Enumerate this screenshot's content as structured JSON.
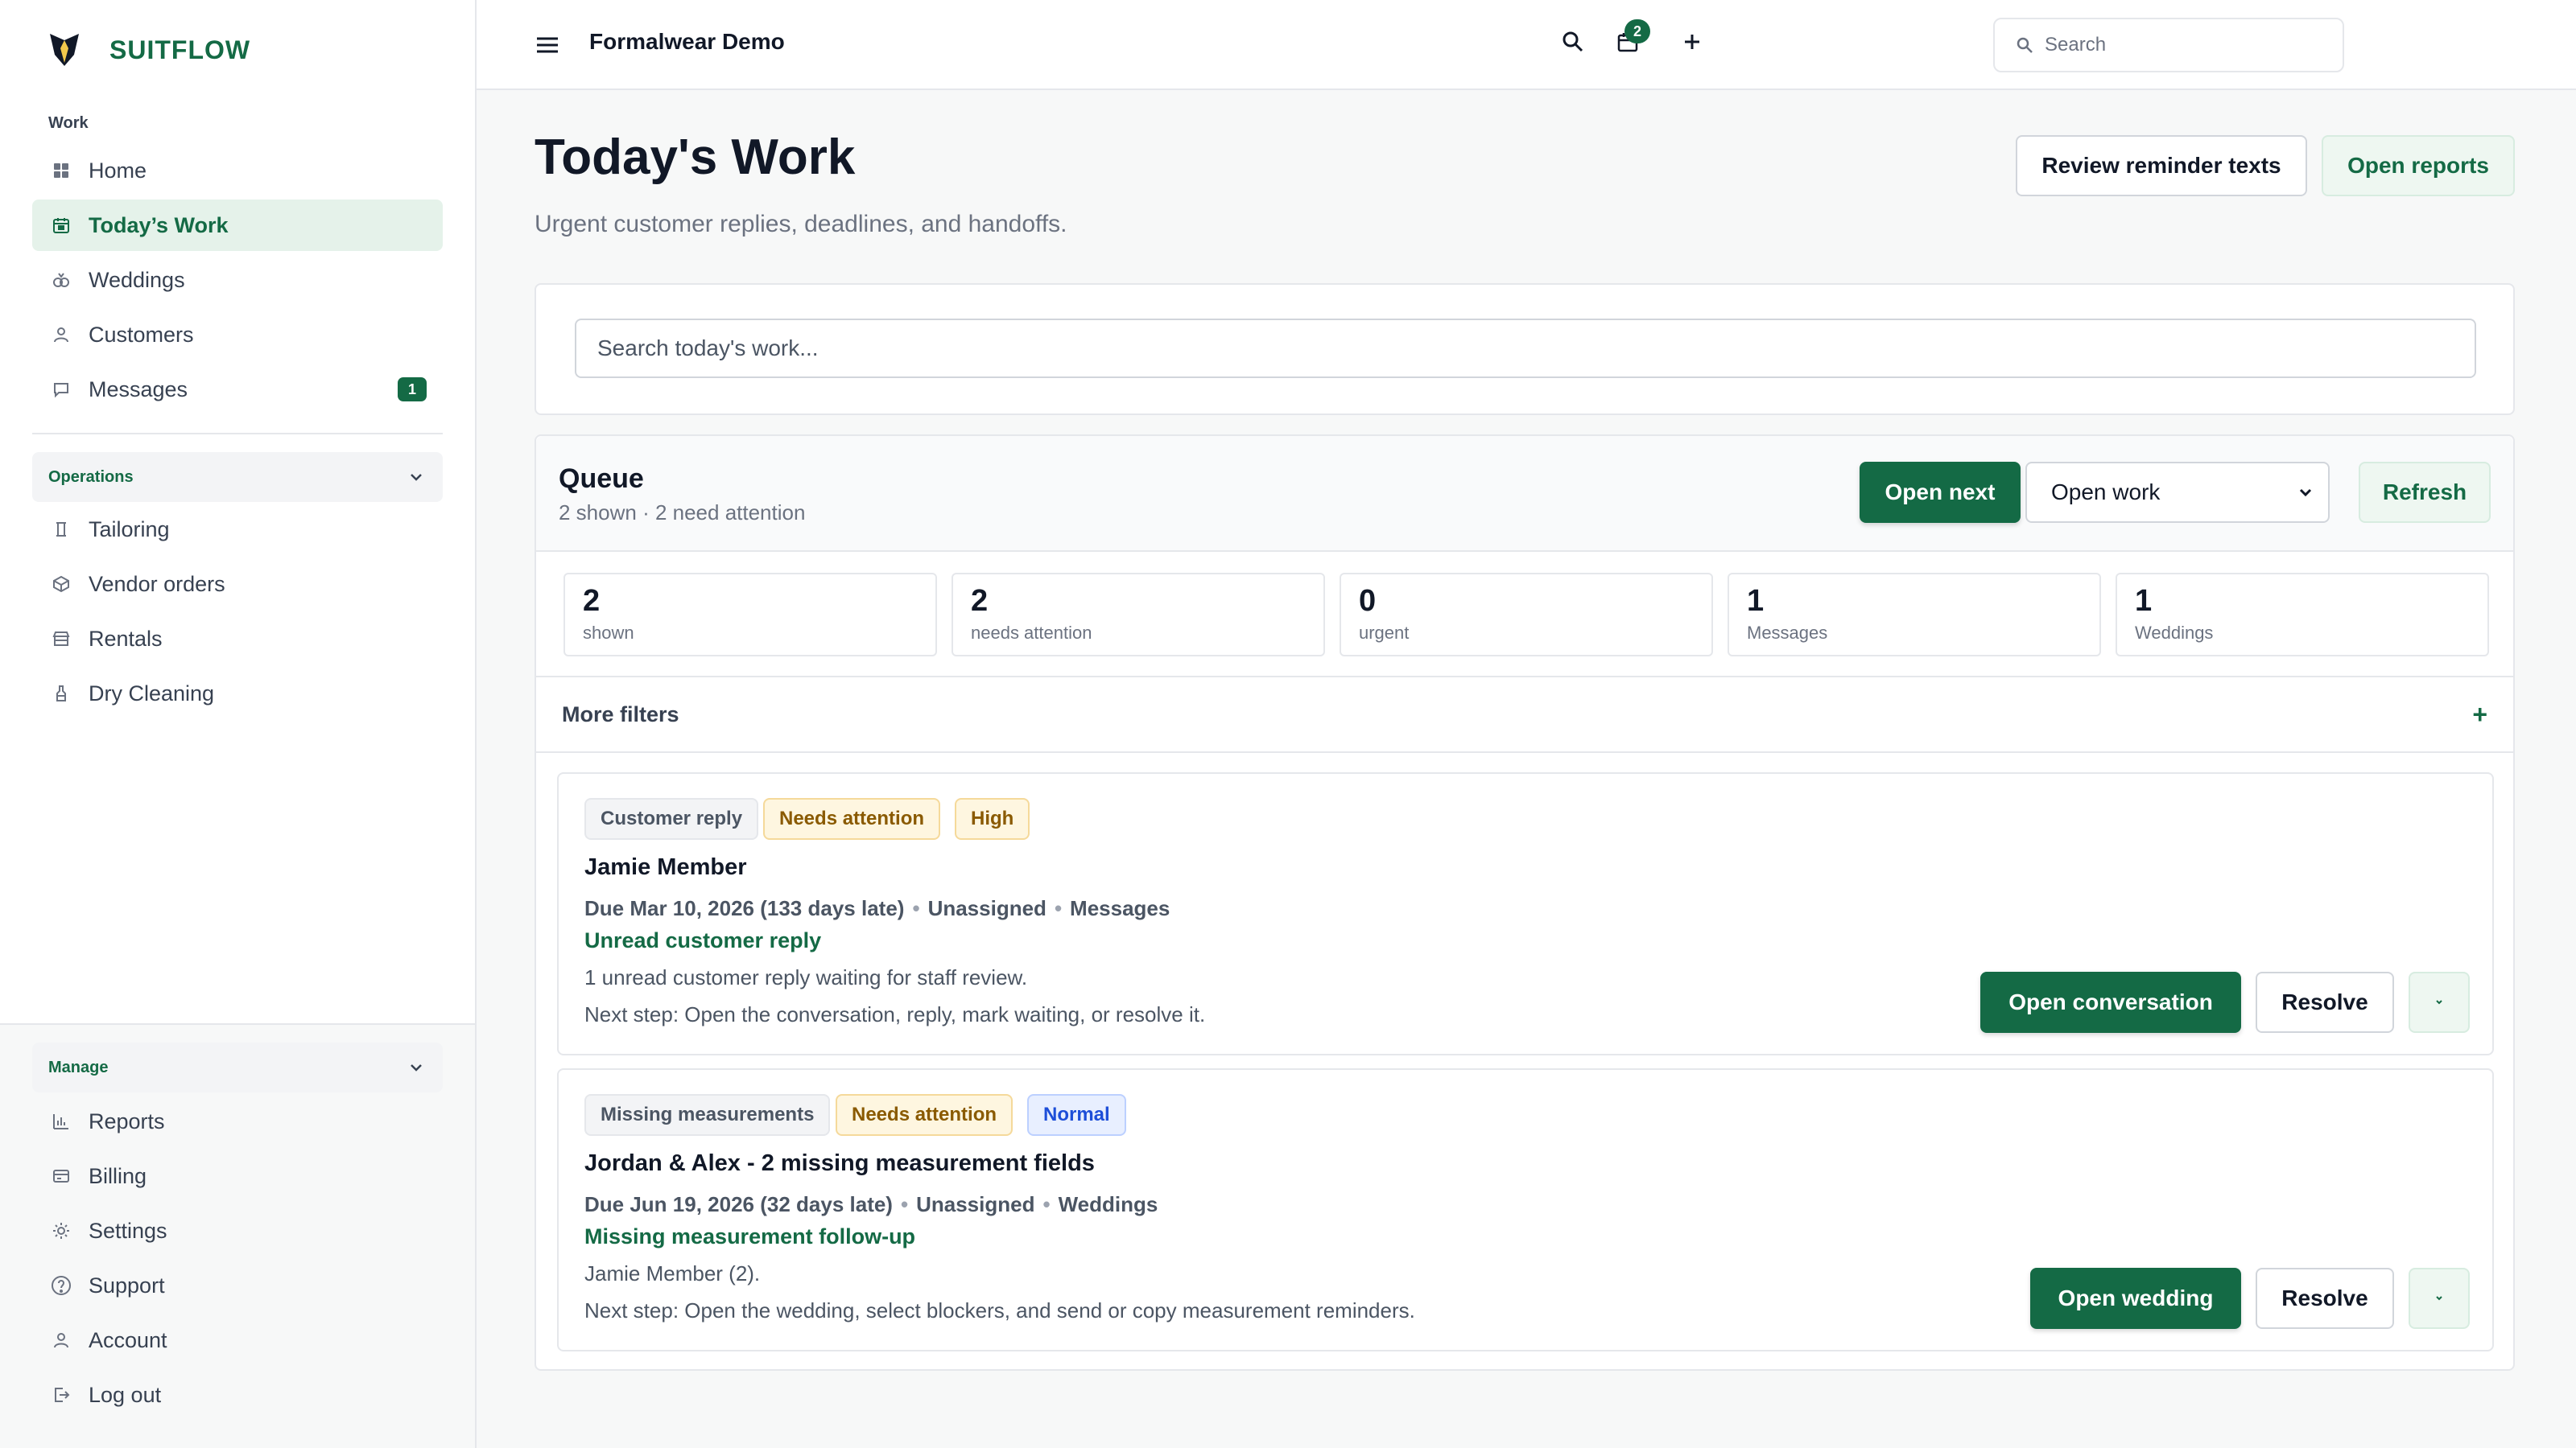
{
  "brand": {
    "name": "SUITFLOW"
  },
  "sidebar": {
    "work_label": "Work",
    "work_items": [
      {
        "label": "Home",
        "icon": "grid-icon"
      },
      {
        "label": "Today’s Work",
        "icon": "calendar-icon",
        "active": true
      },
      {
        "label": "Weddings",
        "icon": "rings-icon"
      },
      {
        "label": "Customers",
        "icon": "person-icon"
      },
      {
        "label": "Messages",
        "icon": "chat-icon",
        "badge": "1"
      }
    ],
    "operations_label": "Operations",
    "operations_items": [
      {
        "label": "Tailoring",
        "icon": "spool-icon"
      },
      {
        "label": "Vendor orders",
        "icon": "box-icon"
      },
      {
        "label": "Rentals",
        "icon": "store-icon"
      },
      {
        "label": "Dry Cleaning",
        "icon": "cleaning-icon"
      }
    ],
    "manage_label": "Manage",
    "manage_items": [
      {
        "label": "Reports",
        "icon": "bar-chart-icon"
      },
      {
        "label": "Billing",
        "icon": "card-icon"
      },
      {
        "label": "Settings",
        "icon": "sun-gear-icon"
      },
      {
        "label": "Support",
        "icon": "help-icon"
      },
      {
        "label": "Account",
        "icon": "person-icon"
      },
      {
        "label": "Log out",
        "icon": "logout-icon"
      }
    ]
  },
  "topbar": {
    "title": "Formalwear Demo",
    "search_placeholder": "Search",
    "notification_count": "2"
  },
  "page": {
    "title": "Today's Work",
    "subtitle": "Urgent customer replies, deadlines, and handoffs.",
    "review_button": "Review reminder texts",
    "reports_button": "Open reports",
    "search_placeholder": "Search today's work..."
  },
  "queue": {
    "title": "Queue",
    "subtitle": "2 shown · 2 need attention",
    "open_next": "Open next",
    "select_value": "Open work",
    "refresh": "Refresh",
    "stats": [
      {
        "num": "2",
        "cap": "shown"
      },
      {
        "num": "2",
        "cap": "needs attention"
      },
      {
        "num": "0",
        "cap": "urgent"
      },
      {
        "num": "1",
        "cap": "Messages"
      },
      {
        "num": "1",
        "cap": "Weddings"
      }
    ],
    "more_filters": "More filters"
  },
  "items": [
    {
      "tags": [
        "Customer reply",
        "Needs attention",
        "High"
      ],
      "title": "Jamie Member",
      "due": "Due Mar 10, 2026 (133 days late)",
      "assignee": "Unassigned",
      "area": "Messages",
      "reason": "Unread customer reply",
      "detail": "1 unread customer reply waiting for staff review.",
      "next": "Next step: Open the conversation, reply, mark waiting, or resolve it.",
      "primary": "Open conversation",
      "resolve": "Resolve"
    },
    {
      "tags": [
        "Missing measurements",
        "Needs attention",
        "Normal"
      ],
      "title": "Jordan & Alex - 2 missing measurement fields",
      "due": "Due Jun 19, 2026 (32 days late)",
      "assignee": "Unassigned",
      "area": "Weddings",
      "reason": "Missing measurement follow-up",
      "detail": "Jamie Member (2).",
      "next": "Next step: Open the wedding, select blockers, and send or copy measurement reminders.",
      "primary": "Open wedding",
      "resolve": "Resolve"
    }
  ]
}
